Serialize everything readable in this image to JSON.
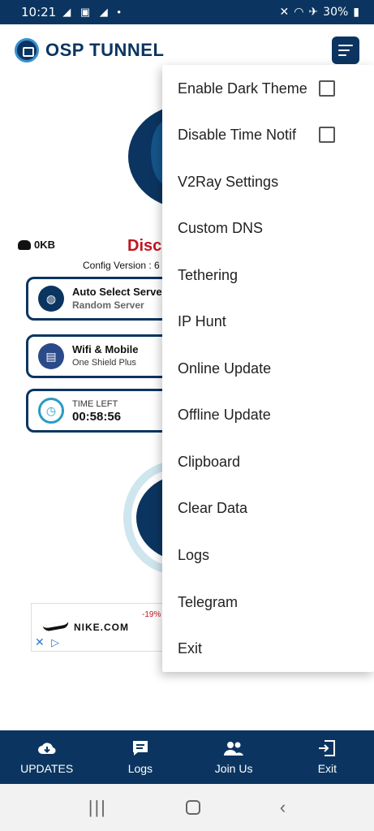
{
  "status_bar": {
    "time": "10:21",
    "battery": "30%"
  },
  "header": {
    "title": "OSP TUNNEL"
  },
  "connection": {
    "data_usage": "0KB",
    "status": "Disc",
    "config_version": "Config Version : 6"
  },
  "cards": {
    "server": {
      "title": "Auto Select Serve",
      "subtitle": "Random Server"
    },
    "network": {
      "title": "Wifi & Mobile",
      "subtitle": "One Shield Plus"
    },
    "timer": {
      "label": "TIME LEFT",
      "value": "00:58:56"
    }
  },
  "ad": {
    "brand": "NIKE.COM",
    "discount": "-19%"
  },
  "menu": {
    "items": [
      {
        "label": "Enable Dark Theme",
        "checkbox": true,
        "checked": false
      },
      {
        "label": "Disable Time Notif",
        "checkbox": true,
        "checked": false
      },
      {
        "label": "V2Ray Settings"
      },
      {
        "label": "Custom DNS"
      },
      {
        "label": "Tethering"
      },
      {
        "label": "IP Hunt"
      },
      {
        "label": "Online Update"
      },
      {
        "label": "Offline Update"
      },
      {
        "label": "Clipboard"
      },
      {
        "label": "Clear Data"
      },
      {
        "label": "Logs"
      },
      {
        "label": "Telegram"
      },
      {
        "label": "Exit"
      }
    ]
  },
  "bottom_nav": {
    "items": [
      {
        "label": "UPDATES",
        "icon": "cloud-download-icon"
      },
      {
        "label": "Logs",
        "icon": "message-icon"
      },
      {
        "label": "Join Us",
        "icon": "group-icon"
      },
      {
        "label": "Exit",
        "icon": "exit-icon"
      }
    ]
  }
}
